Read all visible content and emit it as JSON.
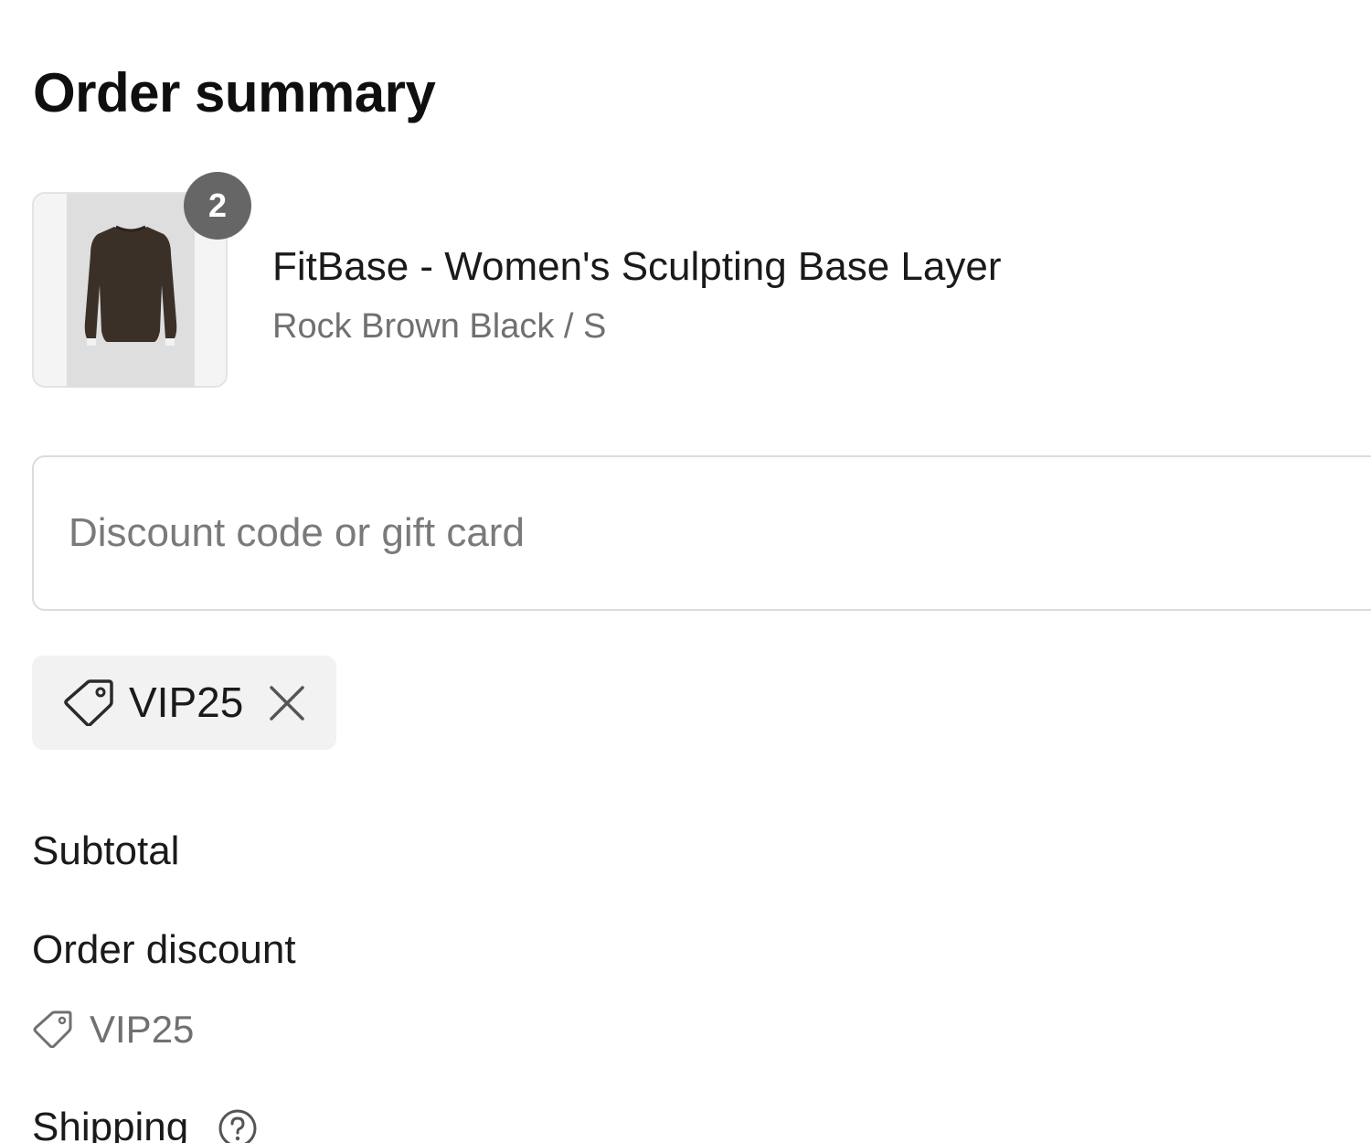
{
  "page": {
    "title": "Order summary"
  },
  "product": {
    "name": "FitBase - Women's Sculpting Base Layer",
    "variant": "Rock Brown Black / S",
    "quantity": "2",
    "image_icon": "long-sleeve-top-photo"
  },
  "discount": {
    "placeholder": "Discount code or gift card",
    "value": ""
  },
  "applied_code": {
    "label": "VIP25",
    "icon": "tag-icon",
    "remove_icon": "close-icon"
  },
  "summary": {
    "subtotal_label": "Subtotal",
    "order_discount_label": "Order discount",
    "order_discount_code": "VIP25",
    "shipping_label": "Shipping",
    "shipping_help_icon": "question-circle-icon"
  },
  "colors": {
    "badge": "#666666",
    "chip_background": "#f2f2f2",
    "muted_text": "#707070",
    "garment": "#3b3028"
  }
}
